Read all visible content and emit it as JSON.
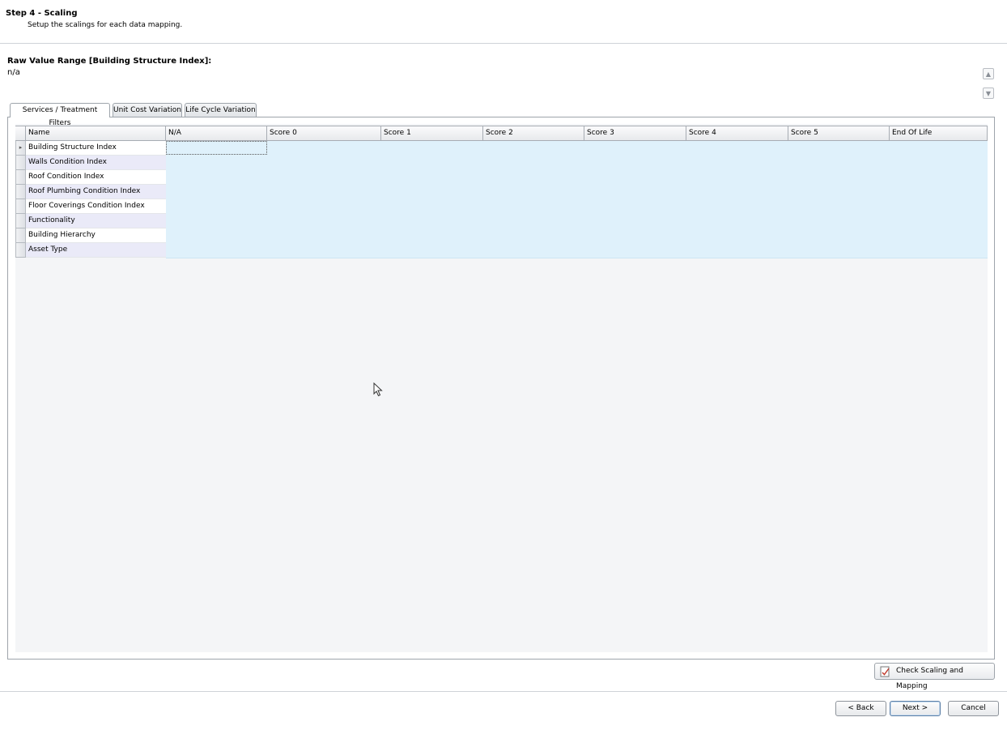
{
  "header": {
    "title": "Step 4 - Scaling",
    "subtitle": "Setup the scalings for each data mapping."
  },
  "raw_range": {
    "label": "Raw Value Range [Building Structure Index]:",
    "value": "n/a"
  },
  "tabs": [
    {
      "label": "Services / Treatment Filters",
      "active": true
    },
    {
      "label": "Unit Cost Variation",
      "active": false
    },
    {
      "label": "Life Cycle Variation",
      "active": false
    }
  ],
  "grid": {
    "columns": [
      "Name",
      "N/A",
      "Score 0",
      "Score 1",
      "Score 2",
      "Score 3",
      "Score 4",
      "Score 5",
      "End Of Life"
    ],
    "rows": [
      {
        "name": "Building Structure Index",
        "current": true
      },
      {
        "name": "Walls Condition Index"
      },
      {
        "name": "Roof Condition Index"
      },
      {
        "name": "Roof Plumbing Condition Index"
      },
      {
        "name": "Floor Coverings Condition Index"
      },
      {
        "name": "Functionality"
      },
      {
        "name": "Building Hierarchy"
      },
      {
        "name": "Asset Type"
      }
    ]
  },
  "buttons": {
    "check": "Check Scaling and Mapping",
    "back": "< Back",
    "next": "Next >",
    "cancel": "Cancel"
  },
  "icons": {
    "scroll_up": "chevron-up-icon",
    "scroll_down": "chevron-down-icon",
    "row_indicator": "triangle-right-icon",
    "check": "document-check-icon",
    "cursor": "mouse-pointer-icon"
  },
  "colors": {
    "data_cell": "#dff1fb",
    "alt_row": "#eaeaf8",
    "border": "#9ea4ab"
  }
}
